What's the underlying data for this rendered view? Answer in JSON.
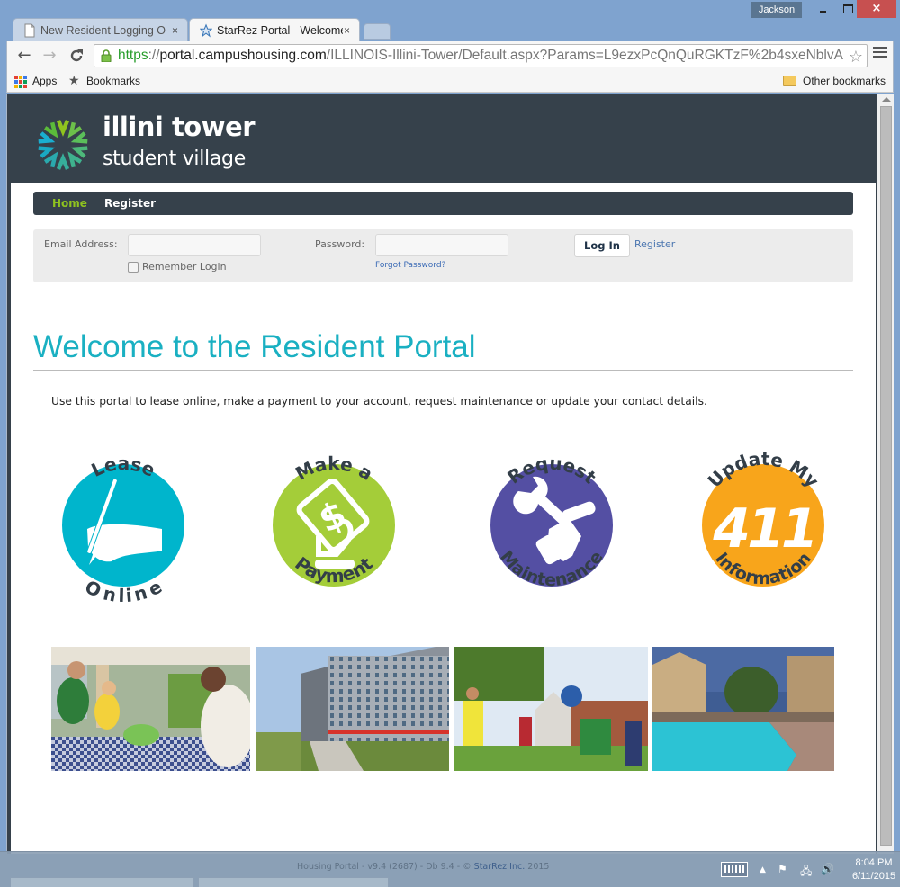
{
  "window": {
    "profile_name": "Jackson",
    "controls": {
      "minimize": "minimize",
      "maximize": "maximize",
      "close": "×"
    }
  },
  "tabs": [
    {
      "title": "New Resident Logging On",
      "icon": "page-icon",
      "active": false,
      "close": "×"
    },
    {
      "title": "StarRez Portal - Welcome",
      "icon": "starrez-star-icon",
      "active": true,
      "close": "×"
    }
  ],
  "toolbar": {
    "back": "←",
    "forward": "→",
    "reload": "C",
    "url": {
      "scheme": "https",
      "separator": "://",
      "host": "portal.campushousing.com",
      "path": "/ILLINOIS-Illini-Tower/Default.aspx?Params=L9ezxPcQnQuRGKTzF%2b4sxeNblvA"
    },
    "bookmark_star": "☆"
  },
  "bookmarks_bar": {
    "items": [
      "Apps",
      "Bookmarks"
    ],
    "other": "Other bookmarks"
  },
  "site": {
    "logo": {
      "title": "illini tower",
      "subtitle": "student village"
    },
    "nav": [
      {
        "label": "Home",
        "active": true
      },
      {
        "label": "Register",
        "active": false
      }
    ],
    "login": {
      "email_label": "Email Address:",
      "email_value": "",
      "password_label": "Password:",
      "password_value": "",
      "remember_label": "Remember Login",
      "remember_checked": false,
      "forgot_label": "Forgot Password?",
      "login_button": "Log In",
      "register_link": "Register"
    },
    "welcome_title": "Welcome to the Resident Portal",
    "intro": "Use this portal to lease online, make a payment to your account, request maintenance or update your contact details.",
    "tiles": [
      {
        "top": "Lease",
        "bottom": "Online",
        "color": "#00b5cc",
        "icon": "hand-writing-icon"
      },
      {
        "top": "Make a",
        "bottom": "Payment",
        "color": "#a4cd39",
        "icon": "dollar-bill-hand-icon"
      },
      {
        "top": "Request",
        "bottom": "Maintenance",
        "color": "#544fa3",
        "icon": "wrench-hand-icon"
      },
      {
        "top": "Update My",
        "bottom": "Information",
        "color": "#f8a51b",
        "icon": "info-411-icon",
        "center_text": "411"
      }
    ],
    "photos": [
      "students-picnic-photo",
      "tower-building-photo",
      "students-playing-ball-photo",
      "pool-apartments-photo"
    ],
    "footer": {
      "prefix": "Housing Portal - v9.4 (2687) - Db 9.4 - © ",
      "link": "StarRez Inc.",
      "suffix": " 2015"
    }
  },
  "taskbar": {
    "time": "8:04 PM",
    "date": "6/11/2015"
  },
  "colors": {
    "brand_dark": "#36414b",
    "nav_active": "#8fc31f",
    "title_teal": "#1ab0c2",
    "link_blue": "#3a6ab5"
  }
}
